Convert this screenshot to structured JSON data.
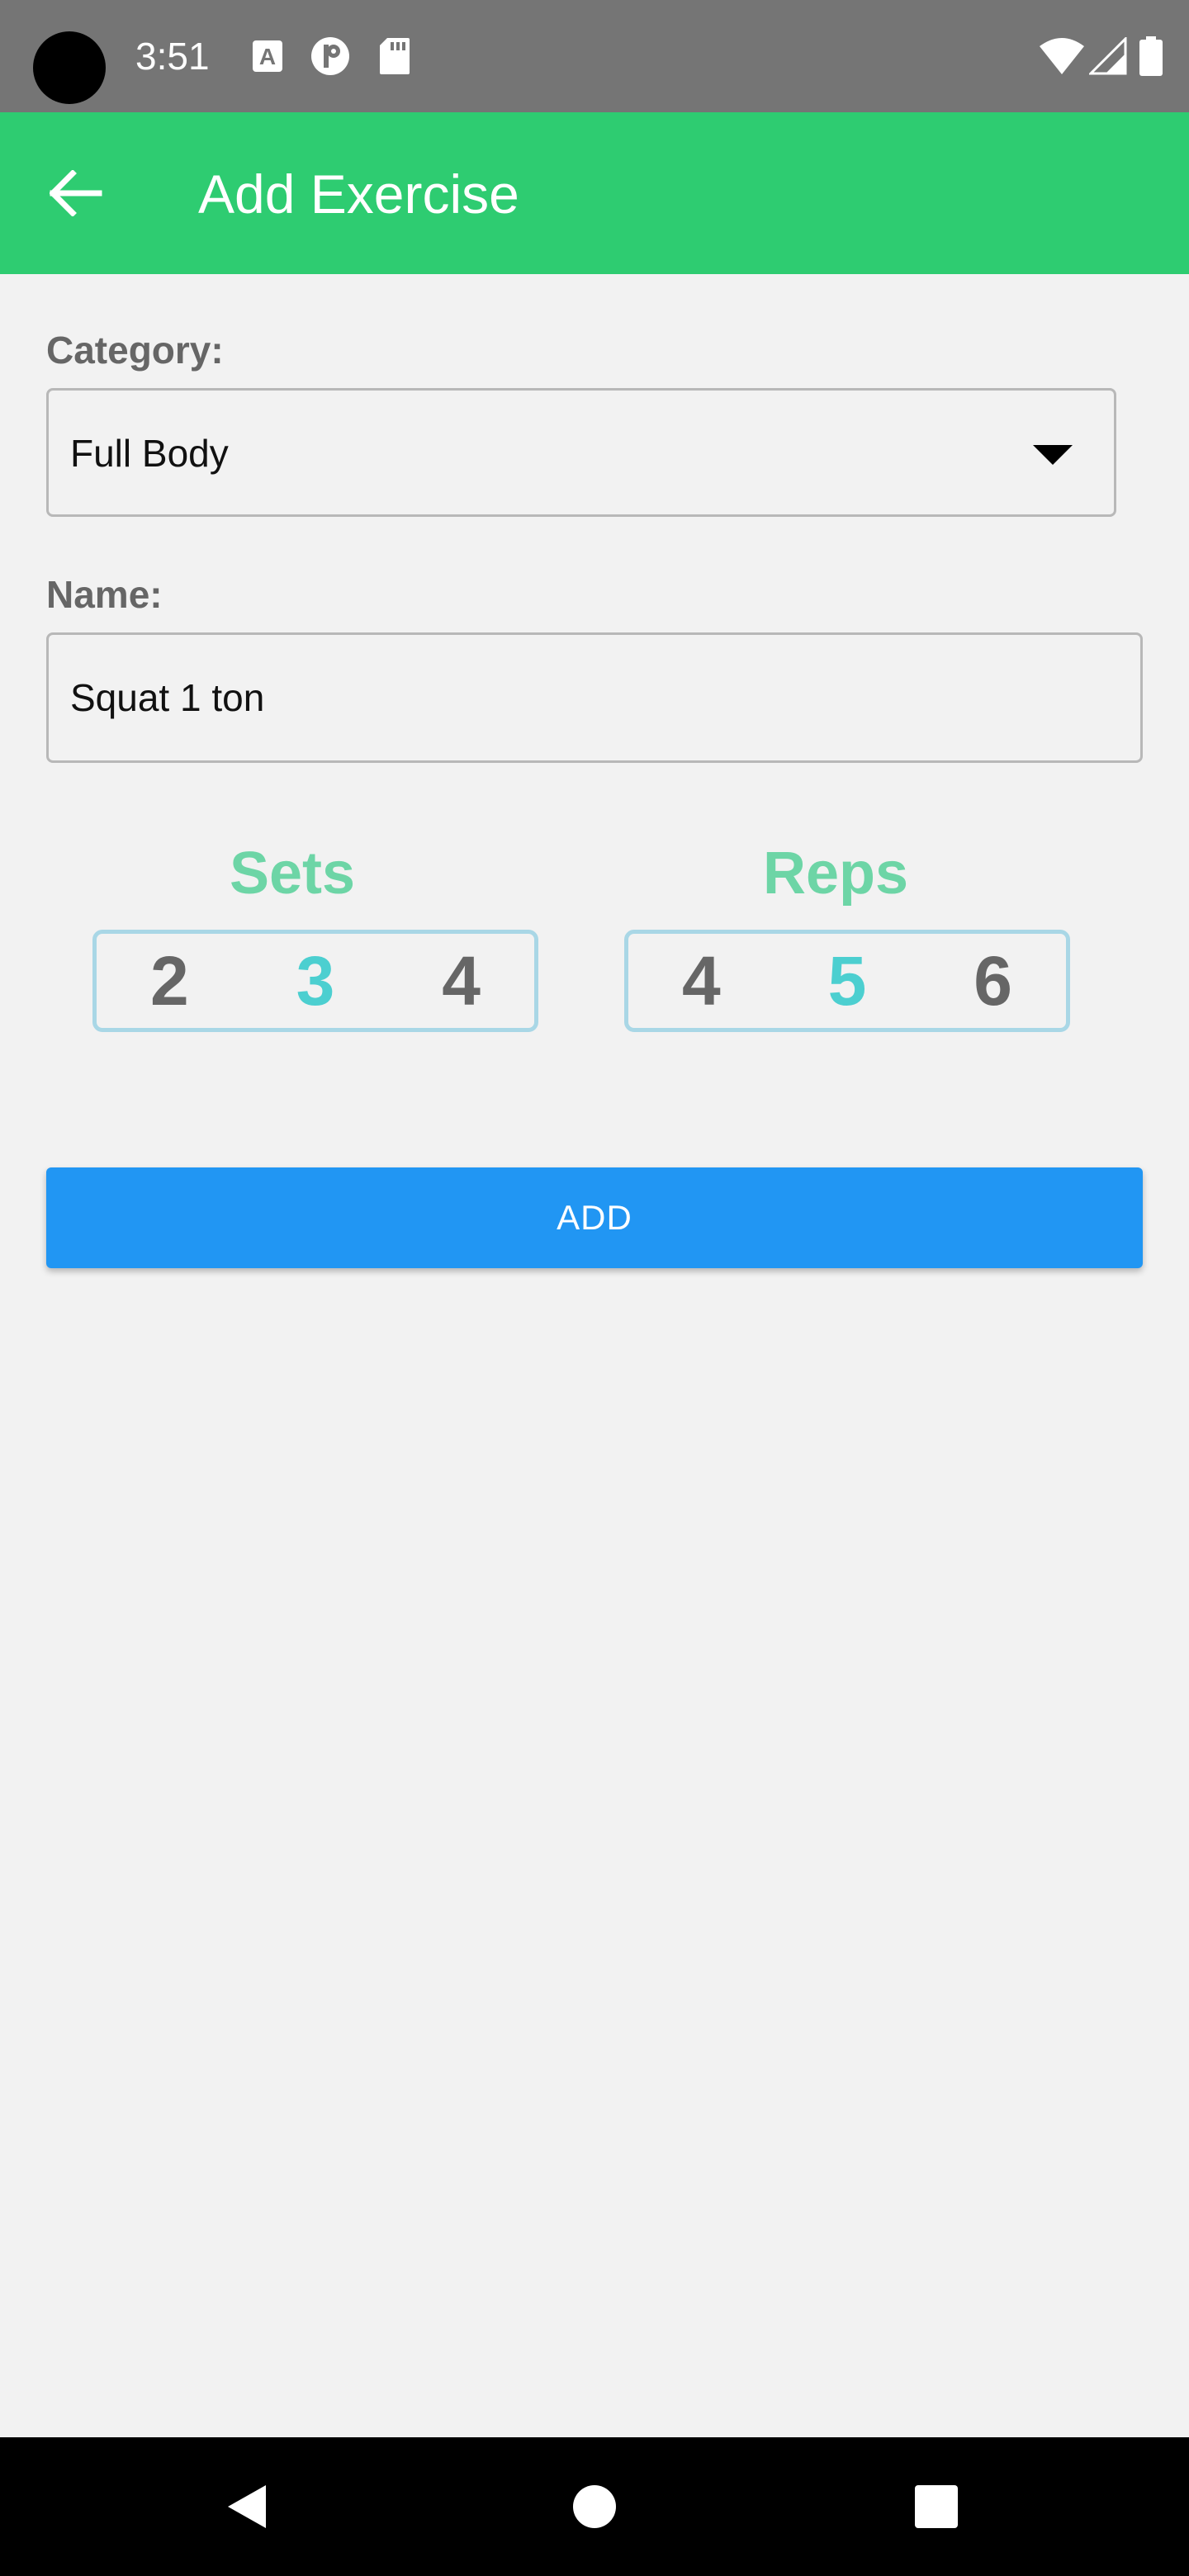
{
  "status_bar": {
    "time": "3:51",
    "icons": [
      "camera-cutout",
      "font-a-icon",
      "p-circle-icon",
      "sd-card-icon",
      "wifi-icon",
      "signal-icon",
      "battery-icon"
    ]
  },
  "app_bar": {
    "title": "Add Exercise",
    "back_icon": "arrow-left-icon"
  },
  "form": {
    "category_label": "Category:",
    "category_value": "Full Body",
    "name_label": "Name:",
    "name_value": "Squat 1 ton"
  },
  "sets": {
    "title": "Sets",
    "values": [
      "2",
      "3",
      "4"
    ],
    "selected": "3"
  },
  "reps": {
    "title": "Reps",
    "values": [
      "4",
      "5",
      "6"
    ],
    "selected": "5"
  },
  "add_button": {
    "label": "ADD"
  },
  "nav_bar": {
    "icons": [
      "back-triangle-icon",
      "home-circle-icon",
      "recents-square-icon"
    ]
  },
  "colors": {
    "status_bar": "#757575",
    "app_bar": "#2ecc71",
    "background": "#f2f2f2",
    "picker_title": "#6dd5a6",
    "picker_selected": "#4ccfd0",
    "picker_border": "#a9d7e6",
    "add_button": "#2196f3"
  }
}
